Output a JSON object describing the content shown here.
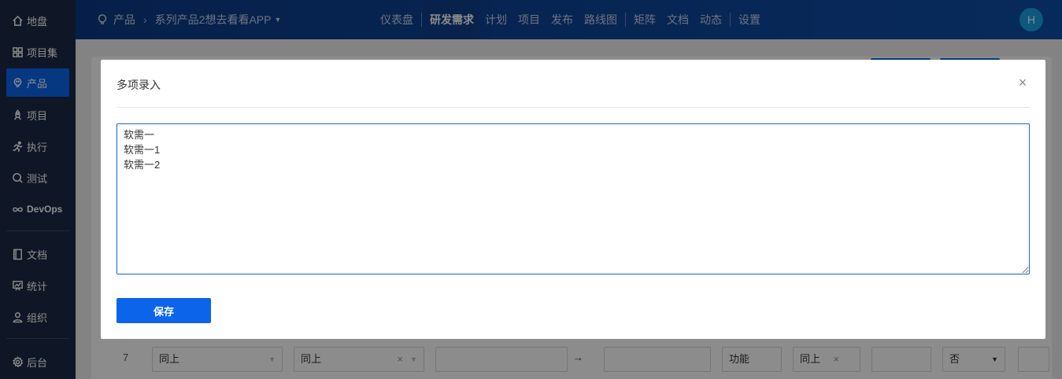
{
  "sidebar": {
    "items": [
      {
        "label": "地盘",
        "icon": "home-icon"
      },
      {
        "label": "项目集",
        "icon": "grid-icon"
      },
      {
        "label": "产品",
        "icon": "lightbulb-icon"
      },
      {
        "label": "项目",
        "icon": "rocket-icon"
      },
      {
        "label": "执行",
        "icon": "run-icon"
      },
      {
        "label": "测试",
        "icon": "search-icon"
      },
      {
        "label": "DevOps",
        "icon": "infinity-icon"
      },
      {
        "label": "文档",
        "icon": "book-icon"
      },
      {
        "label": "统计",
        "icon": "chart-icon"
      },
      {
        "label": "组织",
        "icon": "user-icon"
      },
      {
        "label": "后台",
        "icon": "gear-icon"
      }
    ],
    "active": "产品"
  },
  "header": {
    "breadcrumb_root": "产品",
    "breadcrumb_product": "系列产品2想去看看APP",
    "tabs": [
      "仪表盘",
      "研发需求",
      "计划",
      "项目",
      "发布",
      "路线图",
      "矩阵",
      "文档",
      "动态",
      "设置"
    ],
    "active_tab": "研发需求",
    "avatar_initial": "H"
  },
  "background_row": {
    "number": "7",
    "field1": "同上",
    "field2": "同上",
    "field3": "功能",
    "field4": "同上",
    "field5": "否"
  },
  "modal": {
    "title": "多项录入",
    "textarea_value": "软需一\n软需一1\n软需一2\n",
    "save_label": "保存"
  },
  "colors": {
    "accent": "#0c64eb",
    "sidebar_bg": "#1d2b45",
    "topbar_bg": "#0e4ea8"
  }
}
